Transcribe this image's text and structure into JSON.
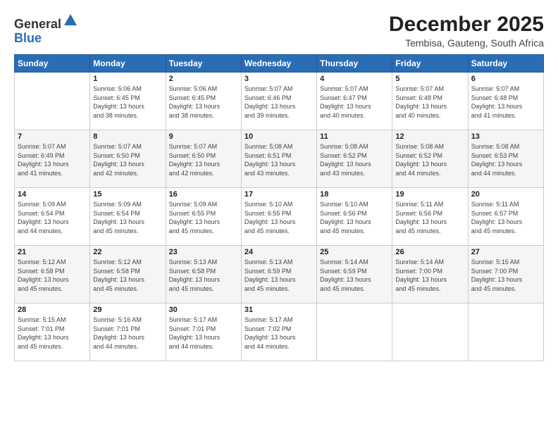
{
  "logo": {
    "general": "General",
    "blue": "Blue"
  },
  "header": {
    "month_year": "December 2025",
    "location": "Tembisa, Gauteng, South Africa"
  },
  "days_of_week": [
    "Sunday",
    "Monday",
    "Tuesday",
    "Wednesday",
    "Thursday",
    "Friday",
    "Saturday"
  ],
  "weeks": [
    [
      {
        "day": "",
        "sunrise": "",
        "sunset": "",
        "daylight": ""
      },
      {
        "day": "1",
        "sunrise": "5:06 AM",
        "sunset": "6:45 PM",
        "daylight": "13 hours and 38 minutes."
      },
      {
        "day": "2",
        "sunrise": "5:06 AM",
        "sunset": "6:45 PM",
        "daylight": "13 hours and 38 minutes."
      },
      {
        "day": "3",
        "sunrise": "5:07 AM",
        "sunset": "6:46 PM",
        "daylight": "13 hours and 39 minutes."
      },
      {
        "day": "4",
        "sunrise": "5:07 AM",
        "sunset": "6:47 PM",
        "daylight": "13 hours and 40 minutes."
      },
      {
        "day": "5",
        "sunrise": "5:07 AM",
        "sunset": "6:48 PM",
        "daylight": "13 hours and 40 minutes."
      },
      {
        "day": "6",
        "sunrise": "5:07 AM",
        "sunset": "6:48 PM",
        "daylight": "13 hours and 41 minutes."
      }
    ],
    [
      {
        "day": "7",
        "sunrise": "5:07 AM",
        "sunset": "6:49 PM",
        "daylight": "13 hours and 41 minutes."
      },
      {
        "day": "8",
        "sunrise": "5:07 AM",
        "sunset": "6:50 PM",
        "daylight": "13 hours and 42 minutes."
      },
      {
        "day": "9",
        "sunrise": "5:07 AM",
        "sunset": "6:50 PM",
        "daylight": "13 hours and 42 minutes."
      },
      {
        "day": "10",
        "sunrise": "5:08 AM",
        "sunset": "6:51 PM",
        "daylight": "13 hours and 43 minutes."
      },
      {
        "day": "11",
        "sunrise": "5:08 AM",
        "sunset": "6:52 PM",
        "daylight": "13 hours and 43 minutes."
      },
      {
        "day": "12",
        "sunrise": "5:08 AM",
        "sunset": "6:52 PM",
        "daylight": "13 hours and 44 minutes."
      },
      {
        "day": "13",
        "sunrise": "5:08 AM",
        "sunset": "6:53 PM",
        "daylight": "13 hours and 44 minutes."
      }
    ],
    [
      {
        "day": "14",
        "sunrise": "5:09 AM",
        "sunset": "6:54 PM",
        "daylight": "13 hours and 44 minutes."
      },
      {
        "day": "15",
        "sunrise": "5:09 AM",
        "sunset": "6:54 PM",
        "daylight": "13 hours and 45 minutes."
      },
      {
        "day": "16",
        "sunrise": "5:09 AM",
        "sunset": "6:55 PM",
        "daylight": "13 hours and 45 minutes."
      },
      {
        "day": "17",
        "sunrise": "5:10 AM",
        "sunset": "6:55 PM",
        "daylight": "13 hours and 45 minutes."
      },
      {
        "day": "18",
        "sunrise": "5:10 AM",
        "sunset": "6:56 PM",
        "daylight": "13 hours and 45 minutes."
      },
      {
        "day": "19",
        "sunrise": "5:11 AM",
        "sunset": "6:56 PM",
        "daylight": "13 hours and 45 minutes."
      },
      {
        "day": "20",
        "sunrise": "5:11 AM",
        "sunset": "6:57 PM",
        "daylight": "13 hours and 45 minutes."
      }
    ],
    [
      {
        "day": "21",
        "sunrise": "5:12 AM",
        "sunset": "6:58 PM",
        "daylight": "13 hours and 45 minutes."
      },
      {
        "day": "22",
        "sunrise": "5:12 AM",
        "sunset": "6:58 PM",
        "daylight": "13 hours and 45 minutes."
      },
      {
        "day": "23",
        "sunrise": "5:13 AM",
        "sunset": "6:58 PM",
        "daylight": "13 hours and 45 minutes."
      },
      {
        "day": "24",
        "sunrise": "5:13 AM",
        "sunset": "6:59 PM",
        "daylight": "13 hours and 45 minutes."
      },
      {
        "day": "25",
        "sunrise": "5:14 AM",
        "sunset": "6:59 PM",
        "daylight": "13 hours and 45 minutes."
      },
      {
        "day": "26",
        "sunrise": "5:14 AM",
        "sunset": "7:00 PM",
        "daylight": "13 hours and 45 minutes."
      },
      {
        "day": "27",
        "sunrise": "5:15 AM",
        "sunset": "7:00 PM",
        "daylight": "13 hours and 45 minutes."
      }
    ],
    [
      {
        "day": "28",
        "sunrise": "5:15 AM",
        "sunset": "7:01 PM",
        "daylight": "13 hours and 45 minutes."
      },
      {
        "day": "29",
        "sunrise": "5:16 AM",
        "sunset": "7:01 PM",
        "daylight": "13 hours and 44 minutes."
      },
      {
        "day": "30",
        "sunrise": "5:17 AM",
        "sunset": "7:01 PM",
        "daylight": "13 hours and 44 minutes."
      },
      {
        "day": "31",
        "sunrise": "5:17 AM",
        "sunset": "7:02 PM",
        "daylight": "13 hours and 44 minutes."
      },
      {
        "day": "",
        "sunrise": "",
        "sunset": "",
        "daylight": ""
      },
      {
        "day": "",
        "sunrise": "",
        "sunset": "",
        "daylight": ""
      },
      {
        "day": "",
        "sunrise": "",
        "sunset": "",
        "daylight": ""
      }
    ]
  ],
  "labels": {
    "sunrise_prefix": "Sunrise: ",
    "sunset_prefix": "Sunset: ",
    "daylight_prefix": "Daylight: "
  }
}
